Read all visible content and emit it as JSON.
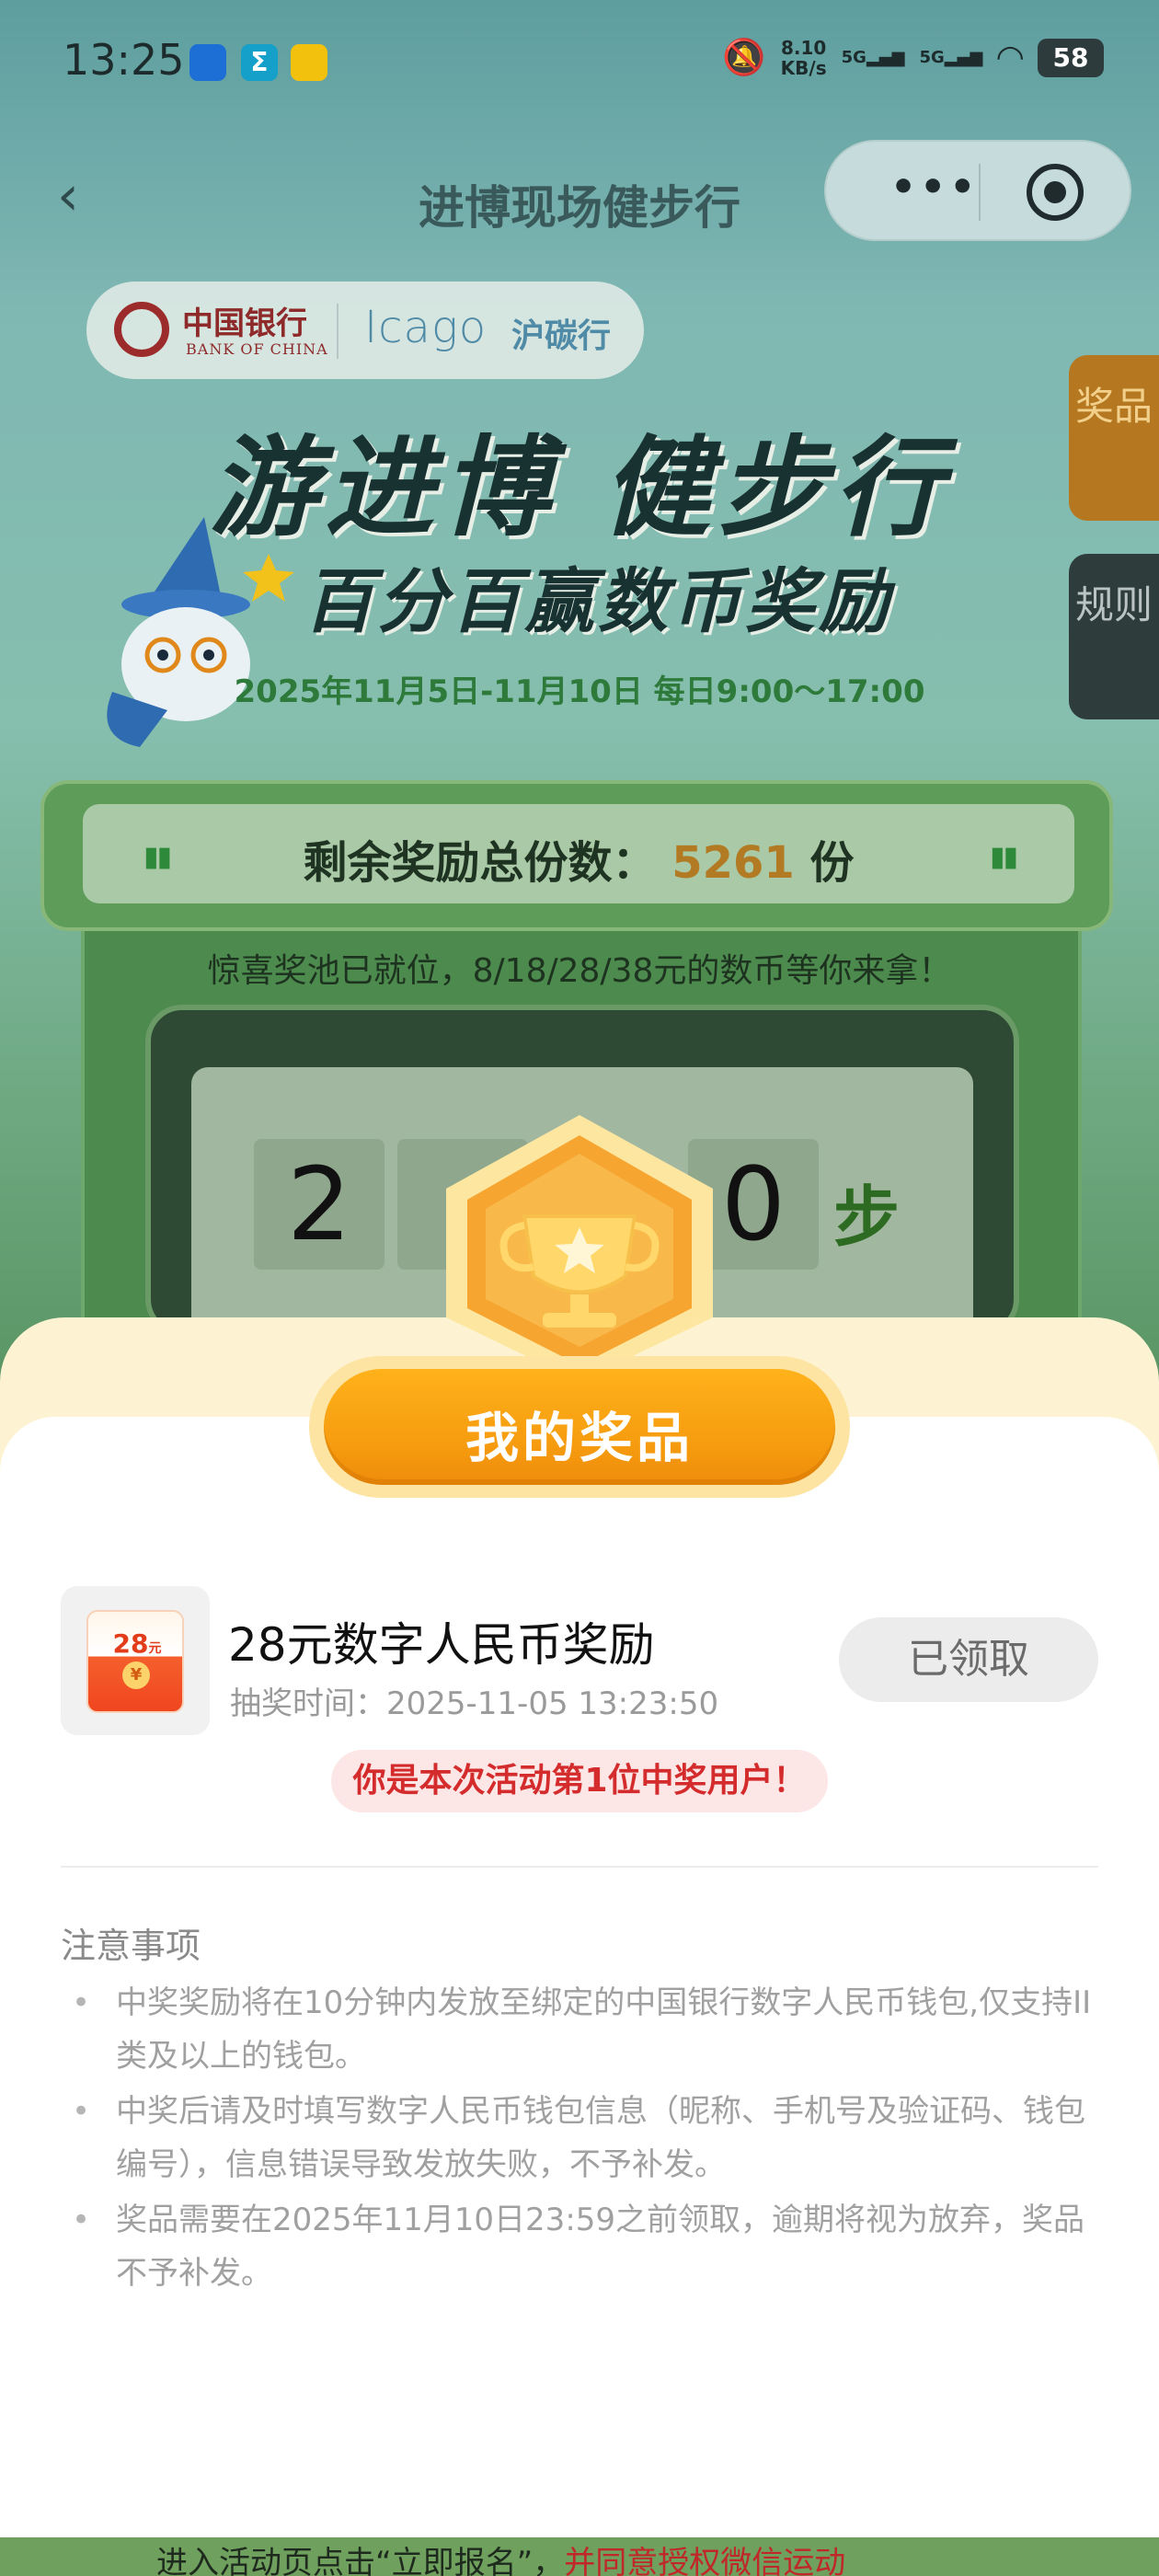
{
  "status_bar": {
    "time": "13:25",
    "network_speed_value": "8.10",
    "network_speed_unit": "KB/s",
    "signal_1": "5G",
    "signal_2": "5G",
    "battery": "58"
  },
  "nav": {
    "title": "进博现场健步行",
    "back_icon": "chevron-left-icon",
    "more_icon": "more-dots-icon",
    "close_icon": "target-icon"
  },
  "logos": {
    "boc_name": "中国银行",
    "boc_sub": "BANK OF CHINA",
    "icago": "Icago",
    "hutan": "沪碳行"
  },
  "side_tabs": {
    "prize": "奖品",
    "rules": "规则"
  },
  "banner": {
    "title": "游进博 健步行",
    "subtitle": "百分百赢数币奖励",
    "date": "2025年11月5日-11月10日 每日9:00～17:00"
  },
  "remaining": {
    "label": "剩余奖励总份数：",
    "count": "5261",
    "unit": "份"
  },
  "pool_text": "惊喜奖池已就位，8/18/28/38元的数币等你来拿！",
  "step_counter": {
    "digit_1": "2",
    "digit_4": "0",
    "unit": "步"
  },
  "sheet": {
    "title": "我的奖品",
    "prize": {
      "thumb_amount": "28",
      "thumb_unit": "元",
      "thumb_coin": "¥",
      "name": "28元数字人民币奖励",
      "time_label": "抽奖时间：",
      "time_value": "2025-11-05 13:23:50",
      "status_button": "已领取"
    },
    "winner_badge": "你是本次活动第1位中奖用户！",
    "notice_title": "注意事项",
    "notices": [
      "中奖奖励将在10分钟内发放至绑定的中国银行数字人民币钱包,仅支持II类及以上的钱包。",
      "中奖后请及时填写数字人民币钱包信息（昵称、手机号及验证码、钱包编号），信息错误导致发放失败，不予补发。",
      "奖品需要在2025年11月10日23:59之前领取，逾期将视为放弃，奖品不予补发。"
    ]
  },
  "bottom_peek": {
    "text_dark": "进入活动页点击“立即报名”，",
    "text_red": "并同意授权微信运动"
  },
  "colors": {
    "accent_orange": "#f59a0f",
    "winner_red": "#d42c2c",
    "count_gold": "#b27a22"
  }
}
